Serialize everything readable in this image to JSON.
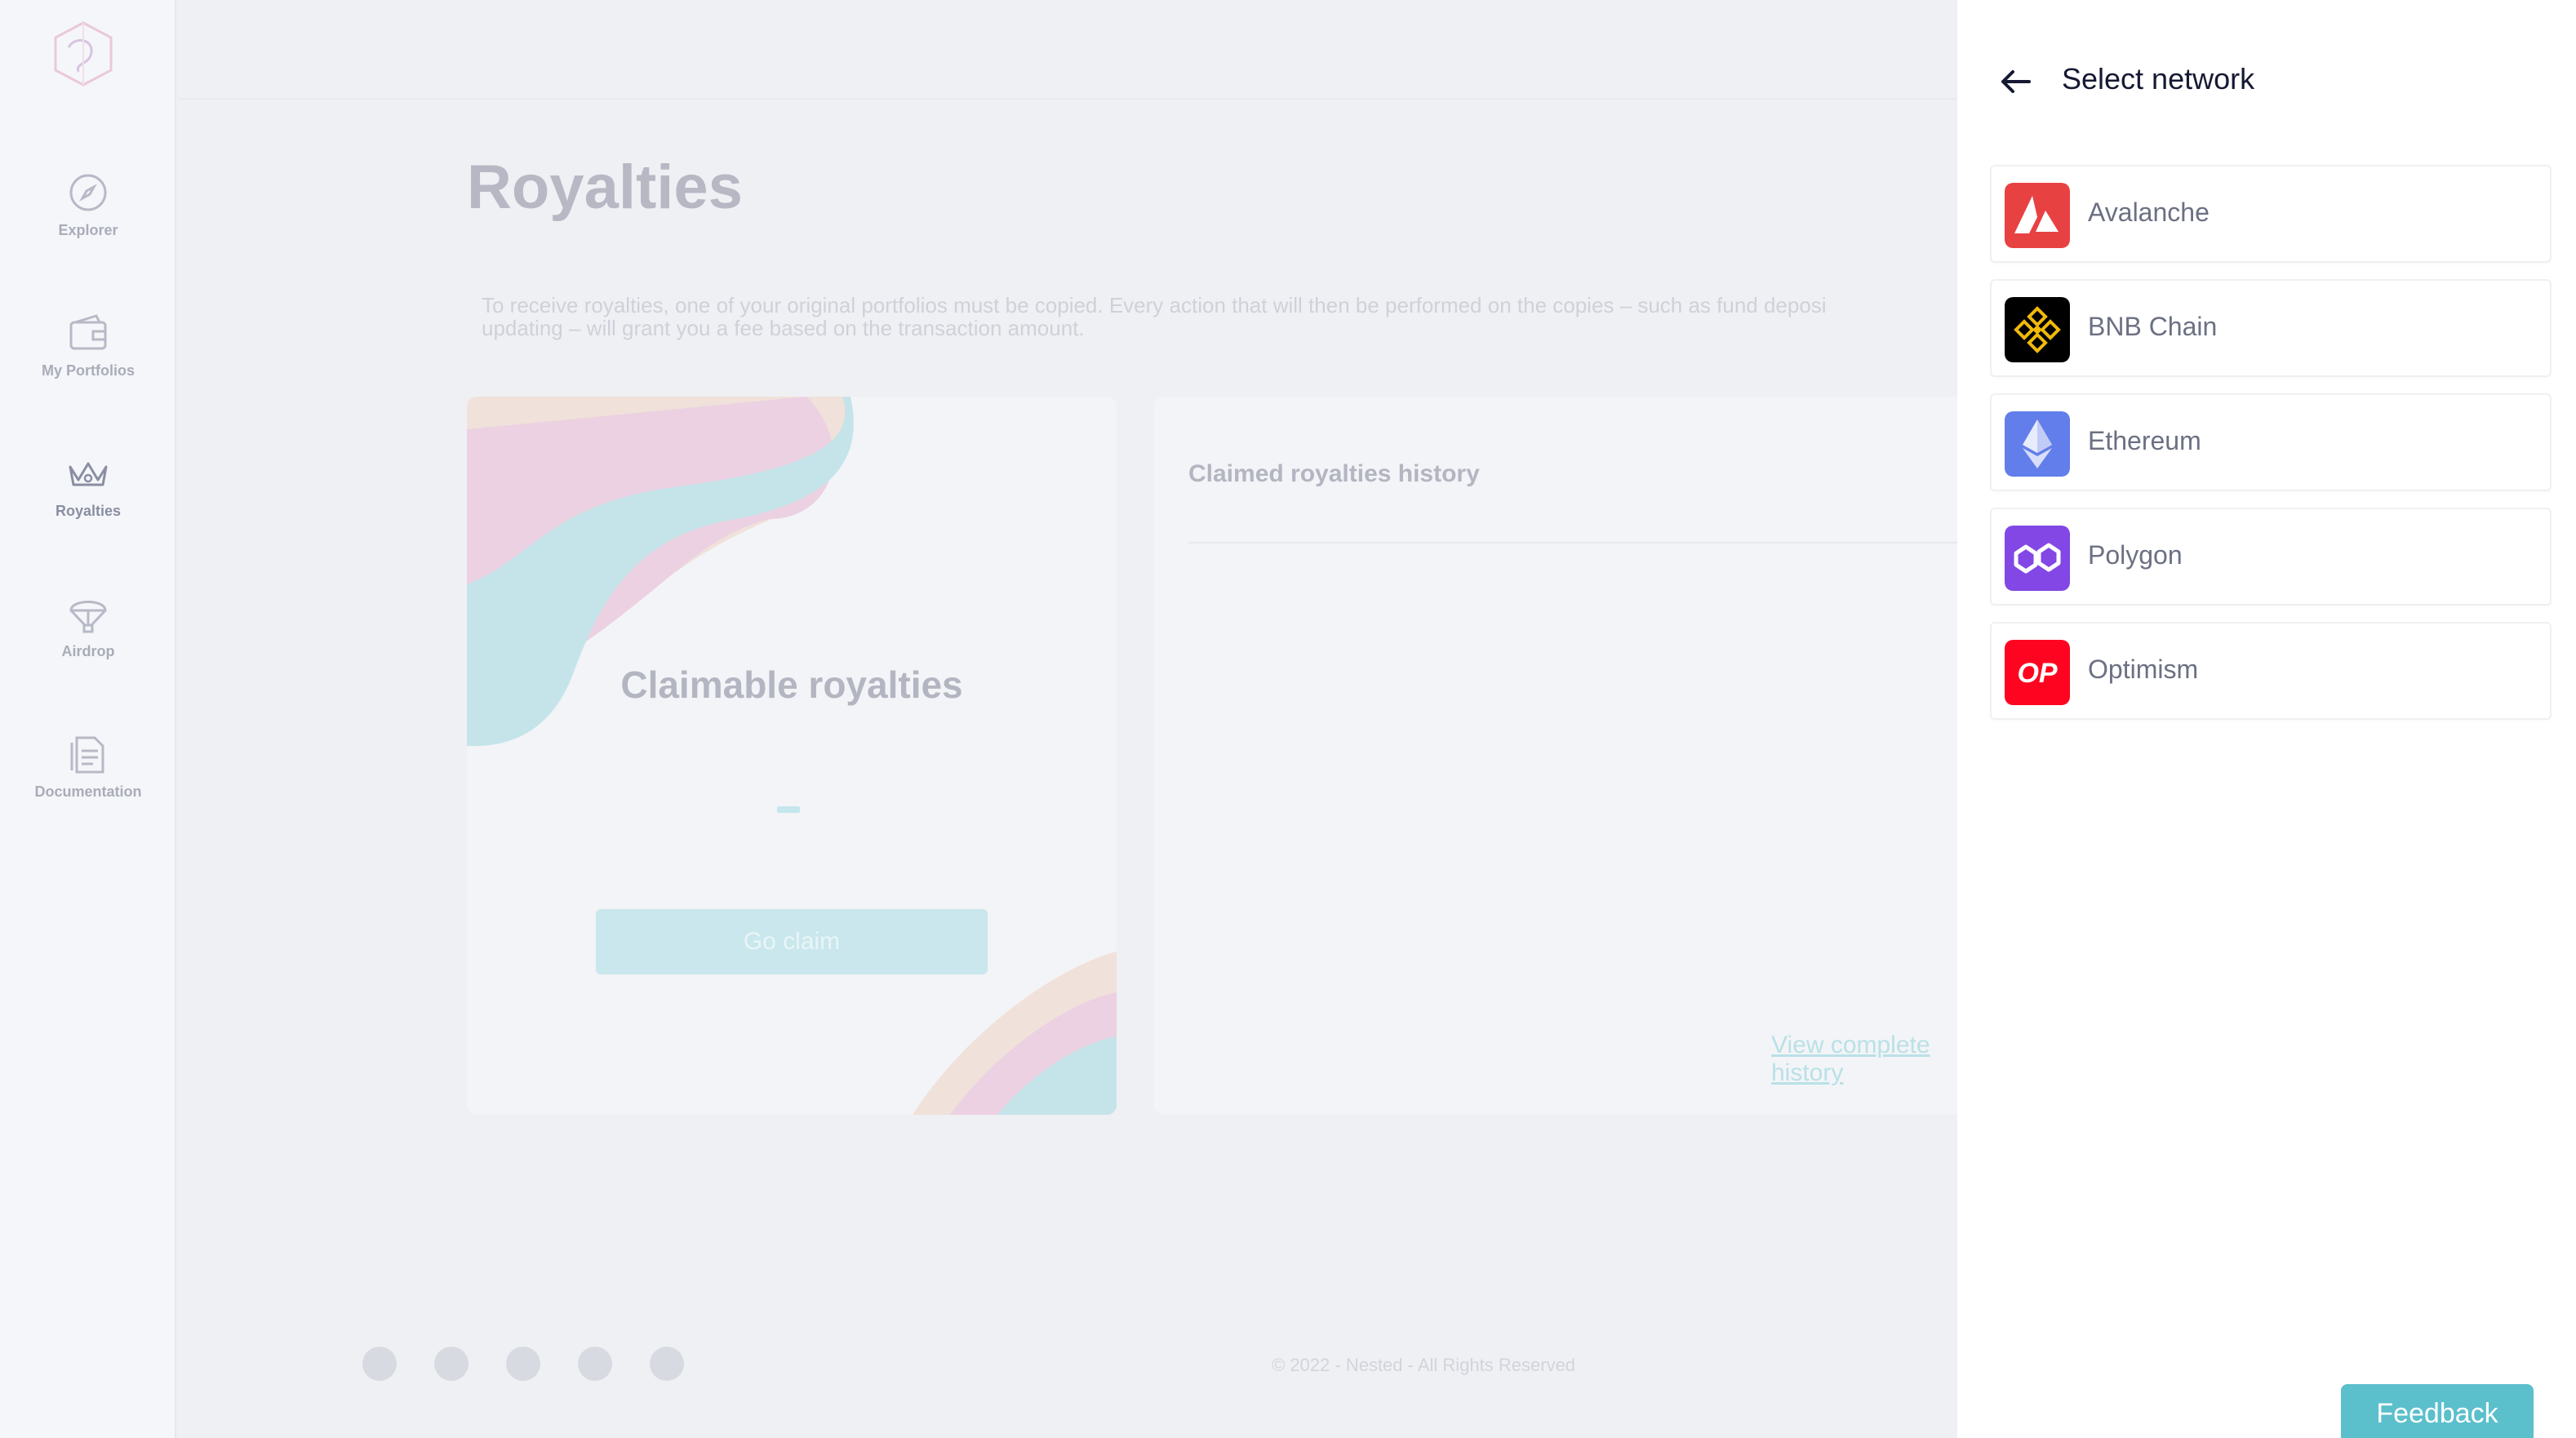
{
  "sidebar": {
    "items": [
      {
        "label": "Explorer",
        "icon": "compass-icon"
      },
      {
        "label": "My Portfolios",
        "icon": "wallet-icon"
      },
      {
        "label": "Royalties",
        "icon": "crown-icon"
      },
      {
        "label": "Airdrop",
        "icon": "parachute-icon"
      },
      {
        "label": "Documentation",
        "icon": "document-icon"
      }
    ]
  },
  "main": {
    "title": "Royalties",
    "intro": "To receive royalties, one of your original portfolios must be copied. Every action that will then be performed on the copies – such as fund deposi\nupdating – will grant you a fee based on the transaction amount.",
    "claim_card": {
      "title": "Claimable royalties",
      "button": "Go claim"
    },
    "history_card": {
      "title": "Claimed royalties history",
      "link": "View complete history"
    }
  },
  "footer": {
    "social": [
      "twitter-icon",
      "telegram-icon",
      "medium-icon",
      "discord-icon",
      "linkedin-icon"
    ],
    "copyright": "© 2022 - Nested - All Rights Reserved"
  },
  "drawer": {
    "title": "Select network",
    "networks": [
      {
        "name": "Avalanche",
        "icon": "avalanche-icon",
        "color": "#e84142"
      },
      {
        "name": "BNB Chain",
        "icon": "bnb-icon",
        "color": "#000000"
      },
      {
        "name": "Ethereum",
        "icon": "ethereum-icon",
        "color": "#627eea"
      },
      {
        "name": "Polygon",
        "icon": "polygon-icon",
        "color": "#8247e5"
      },
      {
        "name": "Optimism",
        "icon": "optimism-icon",
        "color": "#ff0420"
      }
    ]
  },
  "feedback": {
    "label": "Feedback"
  },
  "colors": {
    "accent": "#5bbfcc",
    "drawer_title": "#151932"
  }
}
